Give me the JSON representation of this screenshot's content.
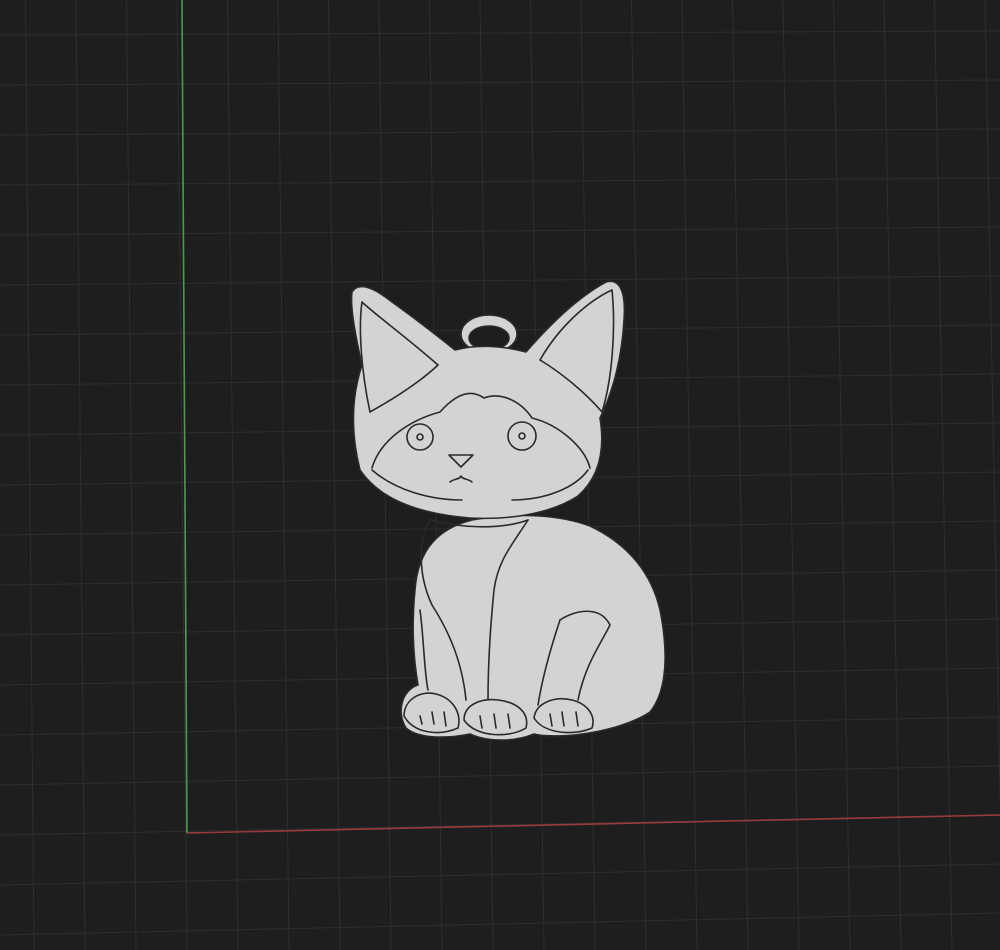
{
  "viewport": {
    "background": "#1e1e1f",
    "grid_minor_color": "#2e2e30",
    "grid_major_color": "#333335",
    "y_axis_color": "#4d9a4d",
    "x_axis_color": "#9a3b3b",
    "grid_visible": true
  },
  "model": {
    "subject": "cat-keychain-pendant",
    "fill_color": "#d3d3d6",
    "outline_color": "#2a2a2a",
    "has_keyring_loop": true
  }
}
